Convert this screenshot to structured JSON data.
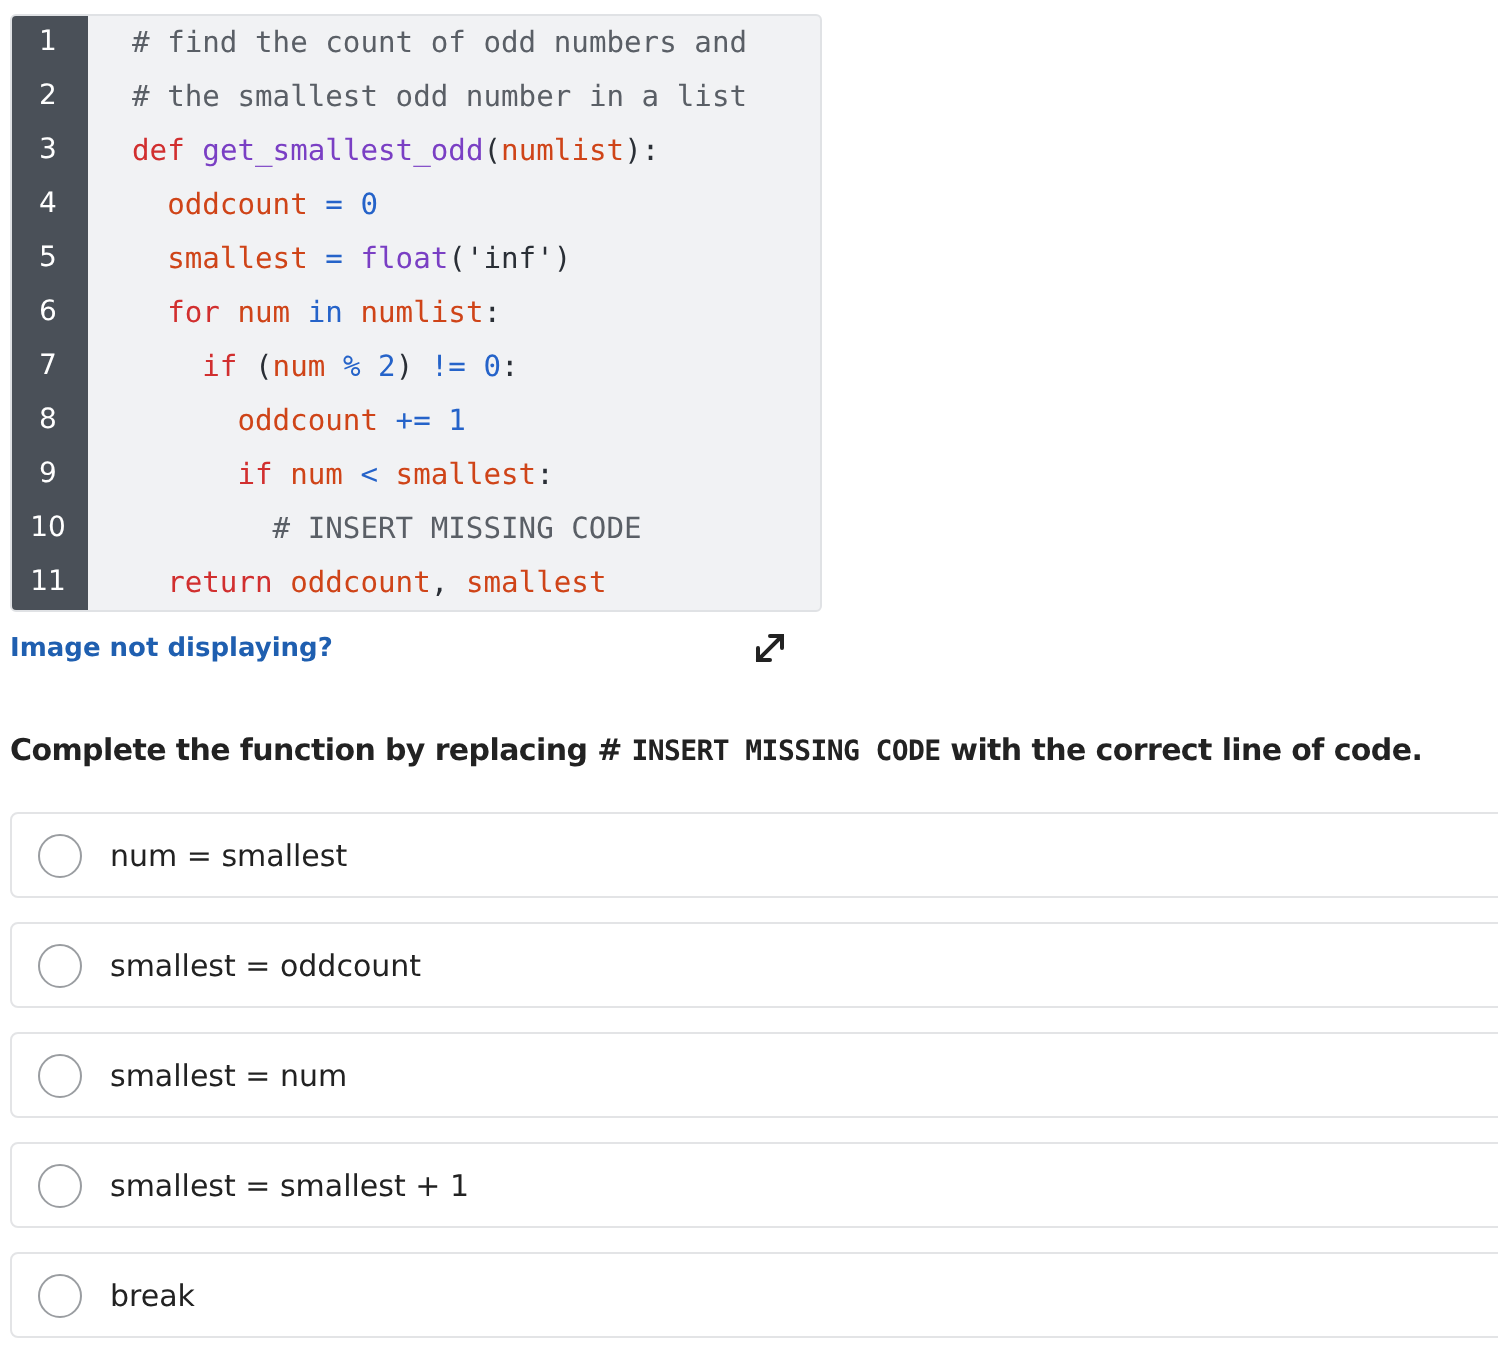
{
  "code": {
    "lines": [
      {
        "number": "1",
        "tokens": [
          {
            "kind": "comment",
            "text": "# find the count of odd numbers and"
          }
        ]
      },
      {
        "number": "2",
        "tokens": [
          {
            "kind": "comment",
            "text": "# the smallest odd number in a list"
          }
        ]
      },
      {
        "number": "3",
        "tokens": [
          {
            "kind": "keyword",
            "text": "def "
          },
          {
            "kind": "func",
            "text": "get_smallest_odd"
          },
          {
            "kind": "plain",
            "text": "("
          },
          {
            "kind": "name",
            "text": "numlist"
          },
          {
            "kind": "plain",
            "text": "):"
          }
        ],
        "children": [
          {
            "number": "4",
            "tokens": [
              {
                "kind": "name",
                "text": "oddcount "
              },
              {
                "kind": "op",
                "text": "= 0"
              }
            ]
          },
          {
            "number": "5",
            "tokens": [
              {
                "kind": "name",
                "text": "smallest "
              },
              {
                "kind": "op",
                "text": "= "
              },
              {
                "kind": "func",
                "text": "float"
              },
              {
                "kind": "plain",
                "text": "('inf')"
              }
            ]
          },
          {
            "number": "6",
            "tokens": [
              {
                "kind": "keyword",
                "text": "for "
              },
              {
                "kind": "name",
                "text": "num "
              },
              {
                "kind": "op",
                "text": "in "
              },
              {
                "kind": "name",
                "text": "numlist"
              },
              {
                "kind": "plain",
                "text": ":"
              }
            ],
            "children": [
              {
                "number": "7",
                "tokens": [
                  {
                    "kind": "keyword",
                    "text": "if "
                  },
                  {
                    "kind": "plain",
                    "text": "("
                  },
                  {
                    "kind": "name",
                    "text": "num "
                  },
                  {
                    "kind": "op",
                    "text": "% 2"
                  },
                  {
                    "kind": "plain",
                    "text": ") "
                  },
                  {
                    "kind": "op",
                    "text": "!= 0"
                  },
                  {
                    "kind": "plain",
                    "text": ":"
                  }
                ],
                "children": [
                  {
                    "number": "8",
                    "tokens": [
                      {
                        "kind": "name",
                        "text": "oddcount "
                      },
                      {
                        "kind": "op",
                        "text": "+= 1"
                      }
                    ]
                  },
                  {
                    "number": "9",
                    "tokens": [
                      {
                        "kind": "keyword",
                        "text": "if "
                      },
                      {
                        "kind": "name",
                        "text": "num "
                      },
                      {
                        "kind": "op",
                        "text": "< "
                      },
                      {
                        "kind": "name",
                        "text": "smallest"
                      },
                      {
                        "kind": "plain",
                        "text": ":"
                      }
                    ],
                    "children": [
                      {
                        "number": "10",
                        "tokens": [
                          {
                            "kind": "comment",
                            "text": "# INSERT MISSING CODE"
                          }
                        ]
                      }
                    ]
                  }
                ]
              }
            ]
          },
          {
            "number": "11",
            "tokens": [
              {
                "kind": "keyword",
                "text": "return "
              },
              {
                "kind": "name",
                "text": "oddcount"
              },
              {
                "kind": "plain",
                "text": ", "
              },
              {
                "kind": "name",
                "text": "smallest"
              }
            ]
          }
        ]
      }
    ]
  },
  "image_link": "Image not displaying?",
  "question": [
    {
      "kind": "text",
      "text": "Complete the function by replacing # "
    },
    {
      "kind": "code",
      "text": "INSERT MISSING CODE"
    },
    {
      "kind": "text",
      "text": " with the correct line of code."
    }
  ],
  "options": [
    {
      "label": "num = smallest",
      "selected": false
    },
    {
      "label": "smallest = oddcount",
      "selected": false
    },
    {
      "label": "smallest = num",
      "selected": false
    },
    {
      "label": "smallest = smallest + 1",
      "selected": false
    },
    {
      "label": "break",
      "selected": false
    }
  ]
}
